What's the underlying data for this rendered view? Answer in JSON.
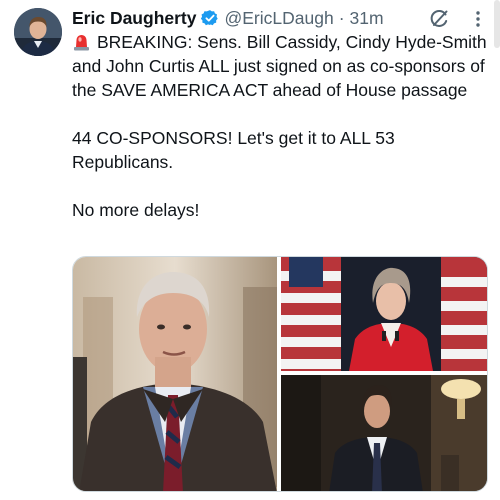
{
  "author": {
    "display_name": "Eric Daugherty",
    "handle": "@EricLDaugh",
    "separator": "·",
    "time": "31m",
    "verified": true,
    "avatar_icon": "profile-photo"
  },
  "tweet": {
    "line1": "BREAKING: Sens. Bill Cassidy, Cindy Hyde-Smith and John Curtis ALL just signed on as co-sponsors of the SAVE AMERICA ACT ahead of House passage",
    "line2": "44 CO-SPONSORS! Let's get it to ALL 53 Republicans.",
    "line3": "No more delays!",
    "lead_icon": "rotating-light-emoji"
  },
  "actions": {
    "grok_icon": "grok-icon",
    "more_icon": "more-options-icon"
  },
  "media": {
    "count": 3,
    "images": [
      "photo-man-hallway",
      "photo-woman-flag",
      "photo-man-corridor"
    ]
  },
  "colors": {
    "text": "#0f1419",
    "secondary": "#536471",
    "verified": "#1d9bf0"
  }
}
